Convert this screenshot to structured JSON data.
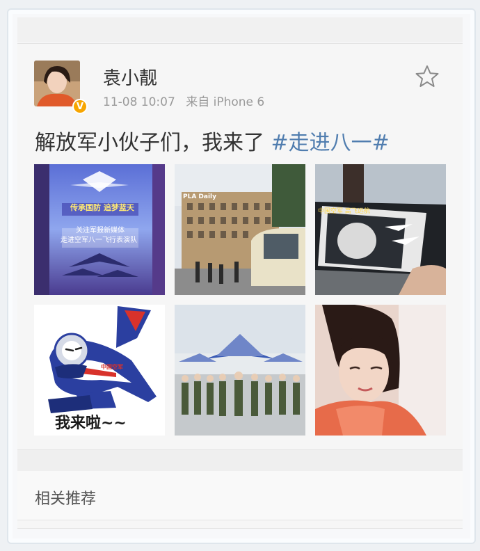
{
  "post": {
    "username": "袁小靓",
    "time": "11-08 10:07",
    "source": "来自 iPhone 6",
    "text": "解放军小伙子们，我来了",
    "topic": "#走进八一#"
  },
  "photos": {
    "p1_banner_top": "传承国防 追梦蓝天",
    "p1_banner_mid": "关注军报新媒体",
    "p1_banner_bot": "走进空军八一飞行表演队",
    "p2_sign": "PLA Daily",
    "p3_caption": "中国空军 高飞远航",
    "p4_caption": "我来啦~~",
    "p4_badge": "中国空军"
  },
  "related": {
    "label": "相关推荐"
  },
  "colors": {
    "topic": "#507daf",
    "verified": "#f7a500"
  },
  "icons": {
    "favorite": "star-icon",
    "verified": "verified-badge-icon"
  }
}
